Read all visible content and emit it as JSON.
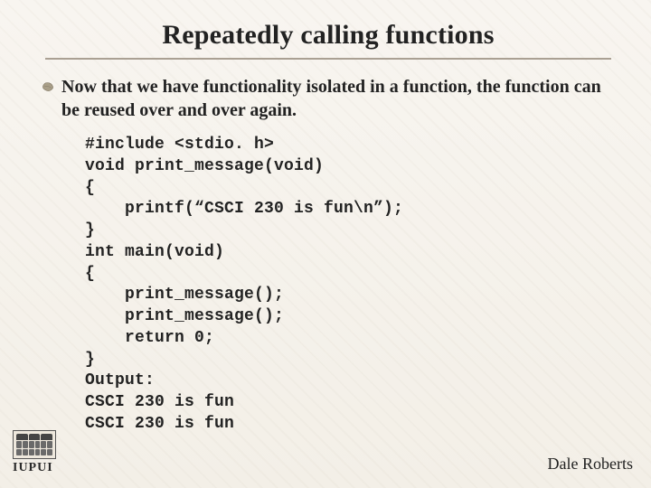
{
  "title": "Repeatedly calling functions",
  "body": "Now that we have functionality isolated in a function, the function can be reused over and over again.",
  "code": "#include <stdio. h>\nvoid print_message(void)\n{\n    printf(“CSCI 230 is fun\\n”);\n}\nint main(void)\n{\n    print_message();\n    print_message();\n    return 0;\n}\nOutput:\nCSCI 230 is fun\nCSCI 230 is fun",
  "author": "Dale Roberts",
  "logo_text": "IUPUI"
}
